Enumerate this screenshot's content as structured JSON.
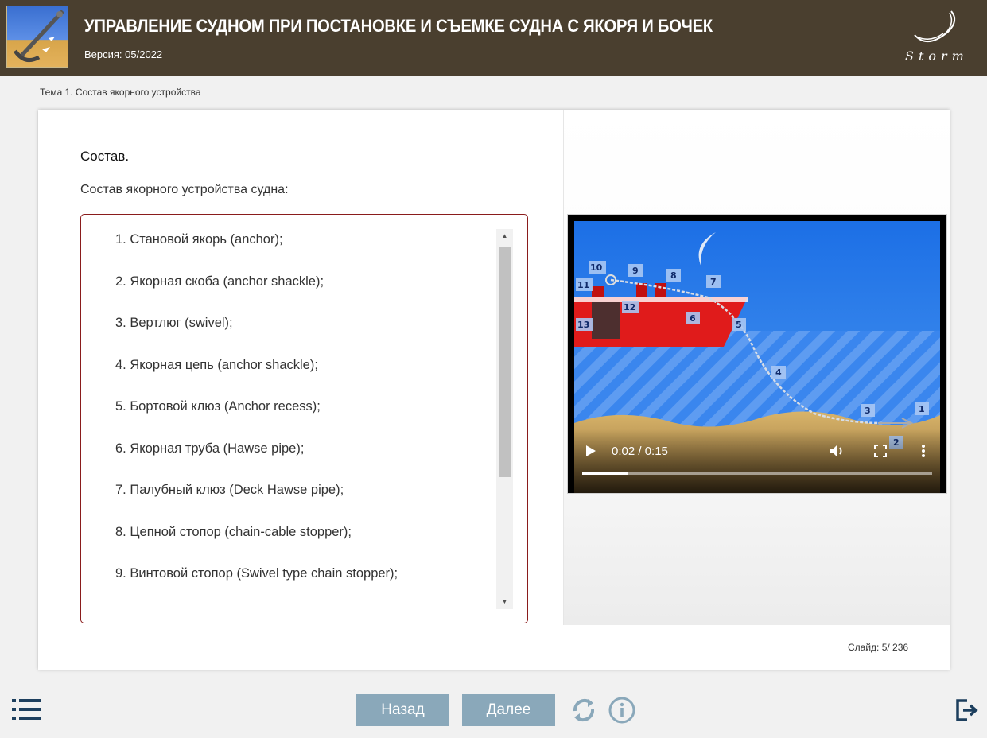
{
  "header": {
    "title": "УПРАВЛЕНИЕ СУДНОМ ПРИ ПОСТАНОВКЕ И СЪЕМКЕ СУДНА С ЯКОРЯ И БОЧЕК",
    "version": "Версия: 05/2022",
    "brand_text": "Storm"
  },
  "breadcrumb": "Тема 1. Состав якорного устройства",
  "content": {
    "section_title": "Состав.",
    "intro": "Состав якорного устройства судна:",
    "items": [
      "1. Становой якорь (anchor);",
      "2. Якорная скоба (anchor shackle);",
      "3. Вертлюг (swivel);",
      "4. Якорная цепь (anchor shackle);",
      "5. Бортовой клюз (Anchor recess);",
      "6. Якорная труба (Hawse pipe);",
      "7. Палубный клюз (Deck Hawse pipe);",
      "8. Цепной стопор (chain-cable stopper);",
      "9. Винтовой стопор (Swivel type chain stopper);"
    ]
  },
  "video": {
    "time": "0:02 / 0:15",
    "progress": 0.13,
    "callouts": [
      "1",
      "2",
      "3",
      "4",
      "5",
      "6",
      "7",
      "8",
      "9",
      "10",
      "11",
      "12",
      "13"
    ]
  },
  "slide_counter": "Слайд:  5/ 236",
  "nav": {
    "back_label": "Назад",
    "next_label": "Далее"
  },
  "icons": {
    "menu": "menu-list-icon",
    "replay": "replay-icon",
    "info": "info-icon",
    "exit": "exit-icon"
  },
  "colors": {
    "header_bg": "#4a3f2f",
    "list_border": "#8a1c1c",
    "button_bg": "#8aa8ba",
    "icon_dark": "#1d3f5e"
  }
}
